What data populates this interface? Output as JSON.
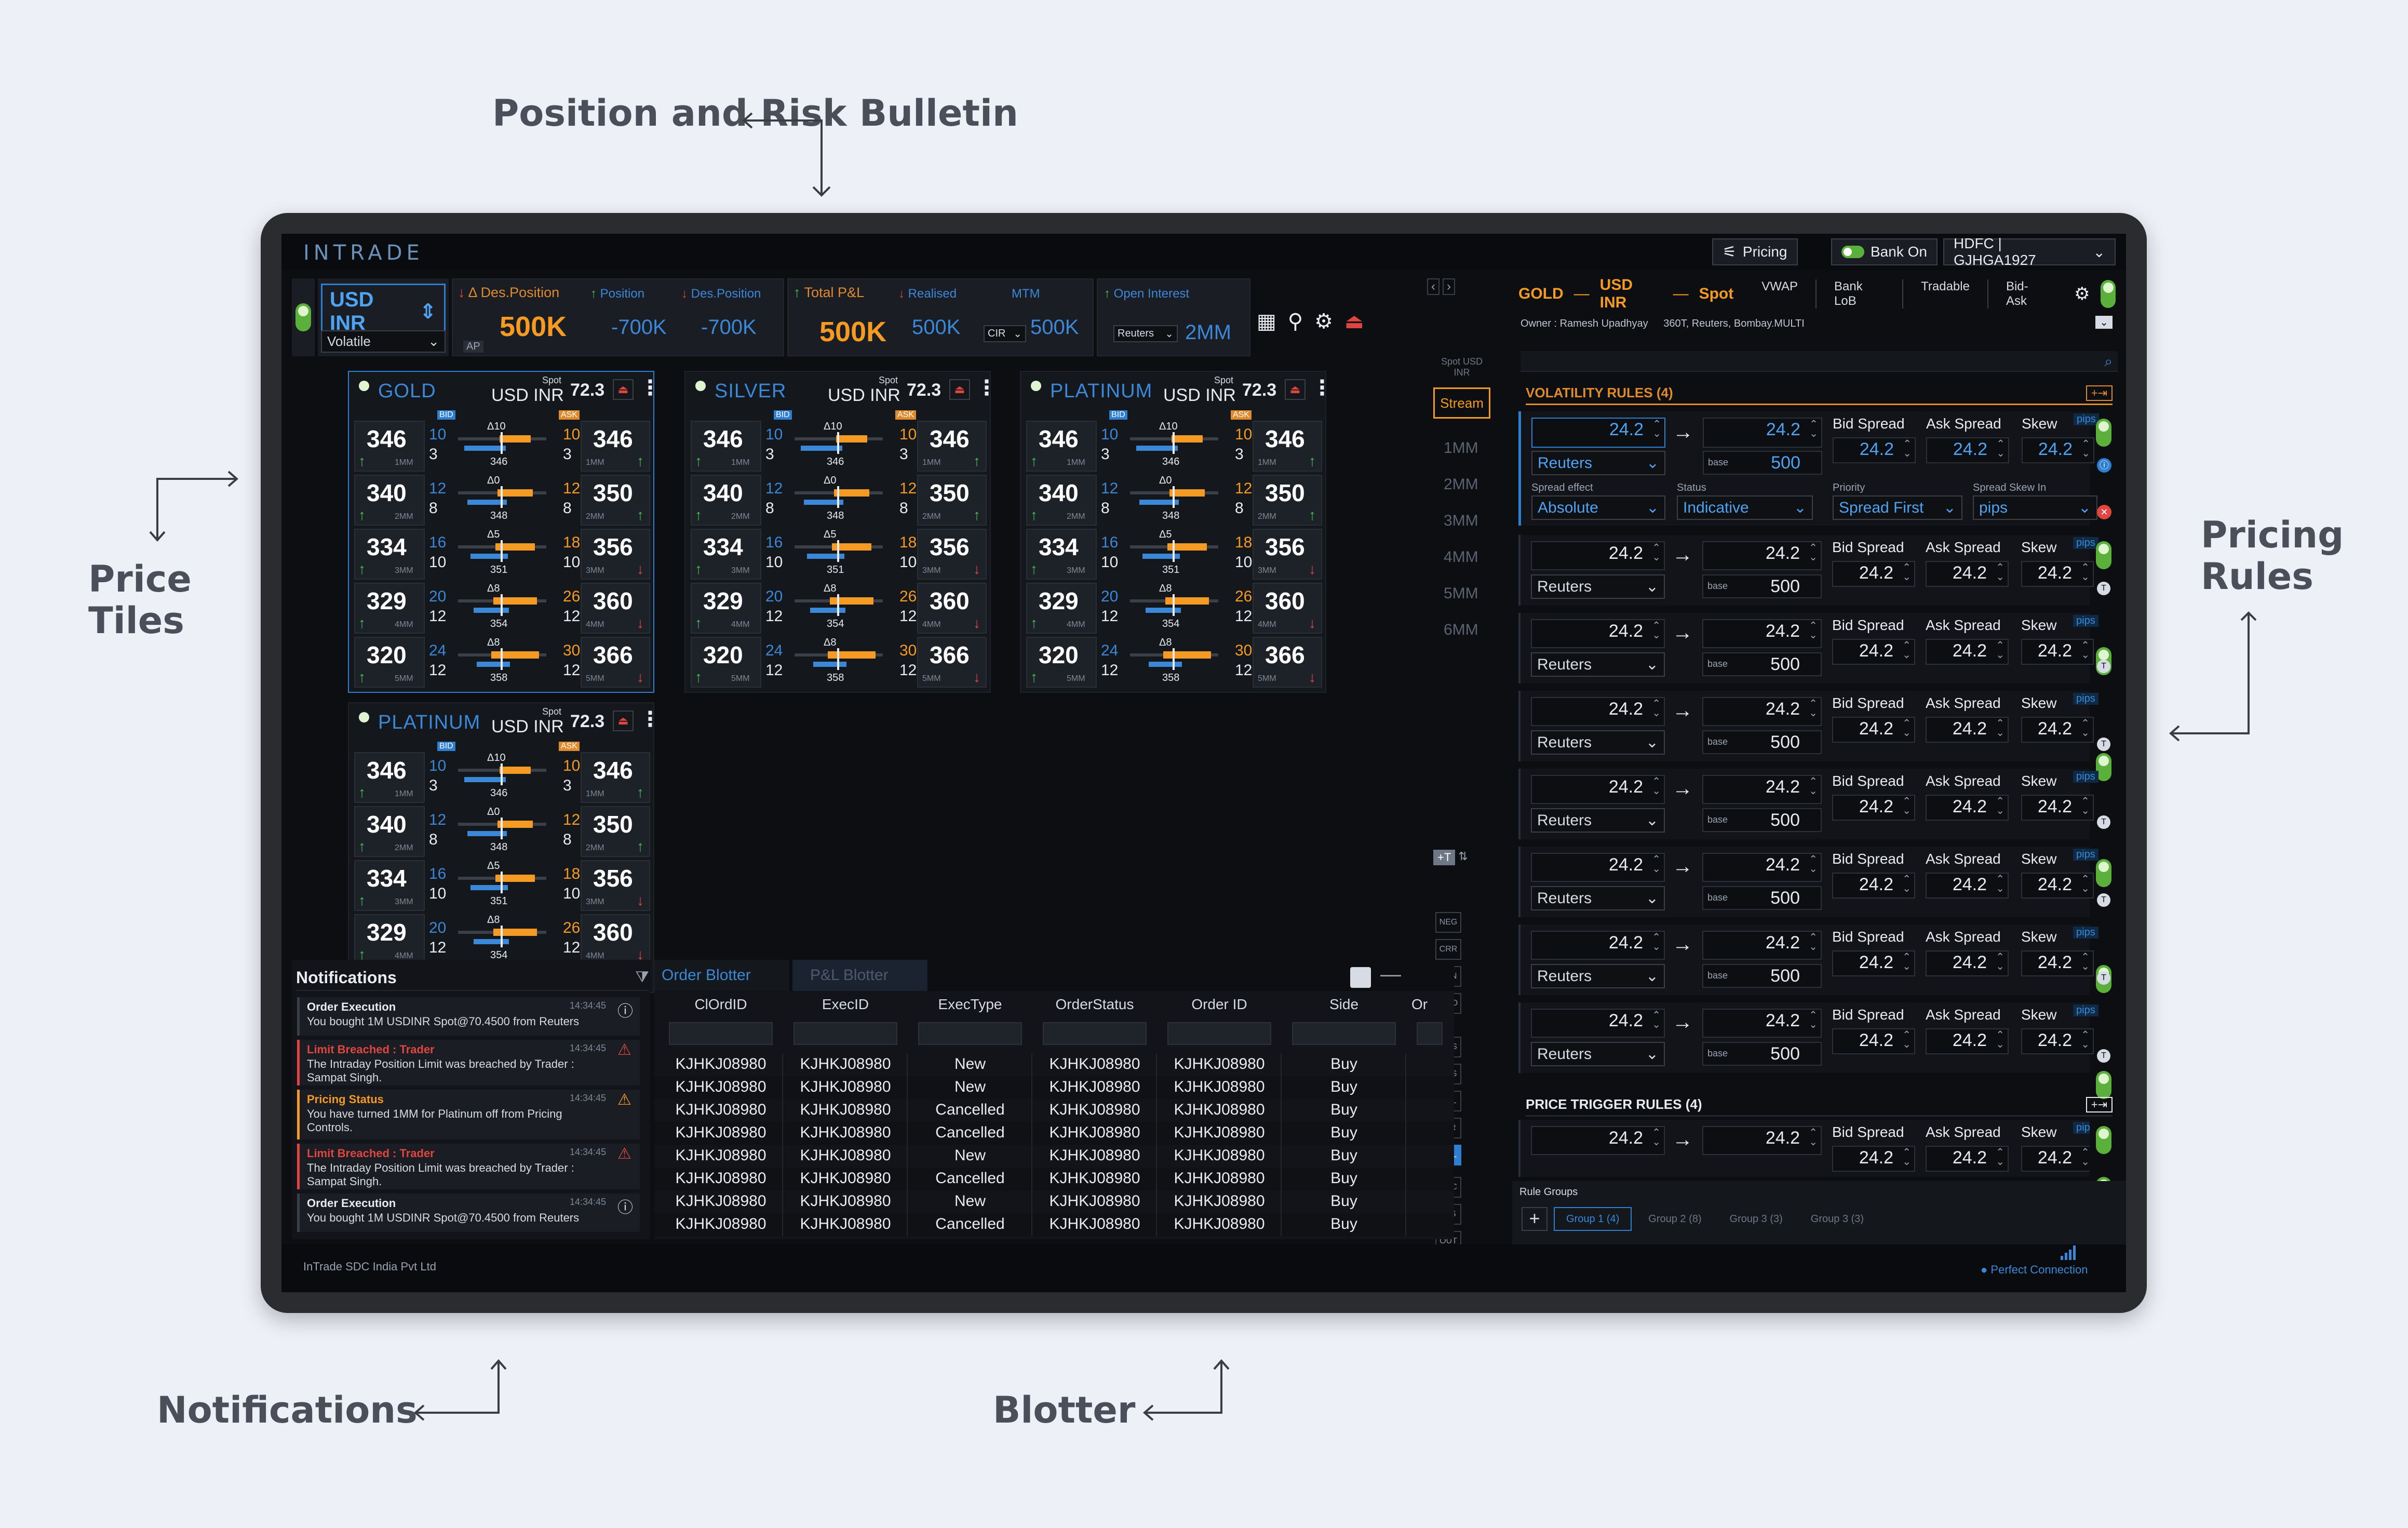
{
  "callouts": {
    "position_bulletin": "Position and Risk Bulletin",
    "price_tiles": "Price Tiles",
    "pricing_rules": "Pricing Rules",
    "notifications": "Notifications",
    "blotter": "Blotter"
  },
  "topbar": {
    "brand": "INTRADE",
    "pricing_label": "Pricing",
    "bank_label": "Bank On",
    "account": "HDFC | GJHGA1927"
  },
  "bulletin": {
    "currency": "USD INR",
    "mode": "Volatile",
    "ap": "AP",
    "des_position_label": "Δ Des.Position",
    "des_position_value": "500K",
    "position_label": "Position",
    "position_value": "-700K",
    "des_position2_label": "Des.Position",
    "des_position2_value": "-700K",
    "pnl_label": "Total P&L",
    "pnl_value": "500K",
    "realised_label": "Realised",
    "realised_value": "500K",
    "mtm_label": "MTM",
    "mtm_value": "500K",
    "mtm_select": "CIR",
    "oi_label": "Open Interest",
    "oi_value": "2MM",
    "oi_select": "Reuters"
  },
  "tile_common": {
    "spot": "Spot",
    "pair": "USD INR",
    "rate": "72.3",
    "bid": "BID",
    "ask": "ASK",
    "rows": [
      {
        "bid": "346",
        "bq": "10",
        "bs": "3",
        "mm": "1MM",
        "delta": "Δ10",
        "mid": "346",
        "aq": "10",
        "as": "3",
        "ask": "346"
      },
      {
        "bid": "340",
        "bq": "12",
        "bs": "8",
        "mm": "2MM",
        "delta": "Δ0",
        "mid": "348",
        "aq": "12",
        "as": "8",
        "ask": "350"
      },
      {
        "bid": "334",
        "bq": "16",
        "bs": "10",
        "mm": "3MM",
        "delta": "Δ5",
        "mid": "351",
        "aq": "18",
        "as": "10",
        "ask": "356"
      },
      {
        "bid": "329",
        "bq": "20",
        "bs": "12",
        "mm": "4MM",
        "delta": "Δ8",
        "mid": "354",
        "aq": "26",
        "as": "12",
        "ask": "360"
      },
      {
        "bid": "320",
        "bq": "24",
        "bs": "12",
        "mm": "5MM",
        "delta": "Δ8",
        "mid": "358",
        "aq": "30",
        "as": "12",
        "ask": "366"
      }
    ]
  },
  "tiles": [
    {
      "name": "GOLD"
    },
    {
      "name": "SILVER"
    },
    {
      "name": "PLATINUM"
    },
    {
      "name": "PLATINUM"
    }
  ],
  "ladder": {
    "head": "Spot USD INR",
    "stream": "Stream",
    "items": [
      "1MM",
      "2MM",
      "3MM",
      "4MM",
      "5MM",
      "6MM"
    ],
    "plus": "+T",
    "tags": [
      "NEG",
      "CRR",
      "SYN",
      "QUO",
      "POS",
      "DES",
      "PNL",
      "LTR",
      "VOL",
      "PRC",
      "FLS",
      "OUT"
    ]
  },
  "rules_header": {
    "gold": "GOLD",
    "pair": "USD INR",
    "spot": "Spot",
    "tabs": [
      "VWAP",
      "Bank LoB",
      "Tradable",
      "Bid-Ask"
    ],
    "owner": "Owner : Ramesh Upadhyay",
    "sources": "360T, Reuters, Bombay.MULTI"
  },
  "vol_rules": {
    "title": "VOLATILITY RULES (4)",
    "first": {
      "left": "24.2",
      "right": "24.2",
      "source": "Reuters",
      "base": "base",
      "base_val": "500",
      "bid_spread_label": "Bid Spread",
      "ask_spread_label": "Ask Spread",
      "skew_label": "Skew",
      "bid_spread": "24.2",
      "ask_spread": "24.2",
      "skew": "24.2",
      "pips": "pips",
      "spread_effect_label": "Spread effect",
      "spread_effect": "Absolute",
      "status_label": "Status",
      "status": "Indicative",
      "priority_label": "Priority",
      "priority": "Spread First",
      "skew_in_label": "Spread Skew In",
      "skew_in": "pips"
    },
    "row": {
      "left": "24.2",
      "right": "24.2",
      "source": "Reuters",
      "base": "base",
      "base_val": "500",
      "bid_spread_label": "Bid Spread",
      "ask_spread_label": "Ask Spread",
      "skew_label": "Skew",
      "bid_spread": "24.2",
      "ask_spread": "24.2",
      "skew": "24.2",
      "pips": "pips"
    }
  },
  "price_trigger": {
    "title": "PRICE TRIGGER RULES (4)",
    "left": "24.2",
    "right": "24.2",
    "bid_spread_label": "Bid Spread",
    "ask_spread_label": "Ask Spread",
    "skew_label": "Skew",
    "bid_spread": "24.2",
    "ask_spread": "24.2",
    "skew": "24.2",
    "pips": "pips"
  },
  "rule_groups": {
    "label": "Rule Groups",
    "groups": [
      "Group 1 (4)",
      "Group 2 (8)",
      "Group 3 (3)",
      "Group 3 (3)"
    ]
  },
  "notifications": {
    "title": "Notifications",
    "items": [
      {
        "title": "Order Execution",
        "time": "14:34:45",
        "body": "You bought 1M USDINR Spot@70.4500 from Reuters",
        "kind": "info"
      },
      {
        "title": "Limit Breached : Trader",
        "time": "14:34:45",
        "body": "The Intraday Position Limit was breached by Trader : Sampat Singh.",
        "kind": "red"
      },
      {
        "title": "Pricing Status",
        "time": "14:34:45",
        "body": "You have turned 1MM for Platinum off from Pricing Controls.",
        "kind": "amber"
      },
      {
        "title": "Limit Breached : Trader",
        "time": "14:34:45",
        "body": "The Intraday Position Limit was breached by Trader : Sampat Singh.",
        "kind": "red"
      },
      {
        "title": "Order Execution",
        "time": "14:34:45",
        "body": "You bought 1M USDINR Spot@70.4500 from Reuters",
        "kind": "info"
      }
    ]
  },
  "blotter": {
    "tab_active": "Order Blotter",
    "tab_other": "P&L Blotter",
    "columns": [
      "ClOrdID",
      "ExecID",
      "ExecType",
      "OrderStatus",
      "Order ID",
      "Side",
      "Or"
    ],
    "rows": [
      [
        "KJHKJ08980",
        "KJHKJ08980",
        "New",
        "KJHKJ08980",
        "KJHKJ08980",
        "Buy"
      ],
      [
        "KJHKJ08980",
        "KJHKJ08980",
        "New",
        "KJHKJ08980",
        "KJHKJ08980",
        "Buy"
      ],
      [
        "KJHKJ08980",
        "KJHKJ08980",
        "Cancelled",
        "KJHKJ08980",
        "KJHKJ08980",
        "Buy"
      ],
      [
        "KJHKJ08980",
        "KJHKJ08980",
        "Cancelled",
        "KJHKJ08980",
        "KJHKJ08980",
        "Buy"
      ],
      [
        "KJHKJ08980",
        "KJHKJ08980",
        "New",
        "KJHKJ08980",
        "KJHKJ08980",
        "Buy"
      ],
      [
        "KJHKJ08980",
        "KJHKJ08980",
        "Cancelled",
        "KJHKJ08980",
        "KJHKJ08980",
        "Buy"
      ],
      [
        "KJHKJ08980",
        "KJHKJ08980",
        "New",
        "KJHKJ08980",
        "KJHKJ08980",
        "Buy"
      ],
      [
        "KJHKJ08980",
        "KJHKJ08980",
        "Cancelled",
        "KJHKJ08980",
        "KJHKJ08980",
        "Buy"
      ]
    ]
  },
  "footer": {
    "company": "InTrade SDC India Pvt Ltd",
    "connection": "Perfect Connection"
  },
  "colors": {
    "accent": "#3b88d8",
    "orange": "#f59a23",
    "green": "#49c157",
    "red": "#e0453f"
  }
}
